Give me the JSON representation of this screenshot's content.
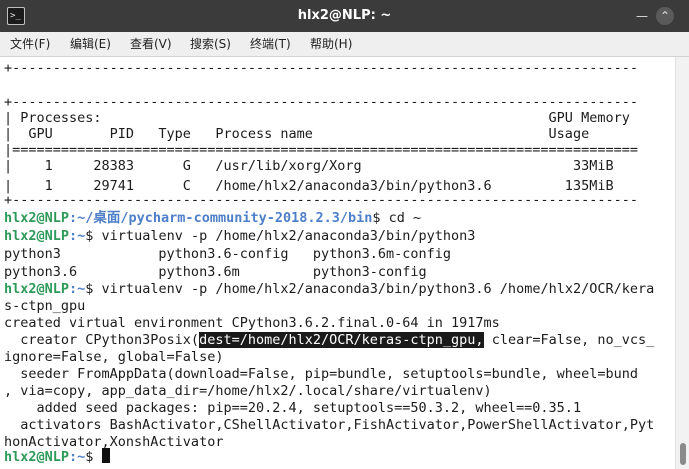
{
  "window": {
    "title": "hlx2@NLP: ~"
  },
  "menu": [
    "文件(F)",
    "编辑(E)",
    "查看(V)",
    "搜索(S)",
    "终端(T)",
    "帮助(H)"
  ],
  "terminal": {
    "lines": [
      "+-----------------------------------------------------------------------------",
      "",
      "+-----------------------------------------------------------------------------",
      "| Processes:                                                       GPU Memory",
      "|  GPU       PID   Type   Process name                             Usage",
      "|=============================================================================",
      "|    1     28383      G   /usr/lib/xorg/Xorg                          33MiB",
      "|    1     29741      C   /home/hlx2/anaconda3/bin/python3.6         135MiB",
      "+-----------------------------------------------------------------------------"
    ],
    "prompt_user": "hlx2@NLP",
    "session": [
      {
        "path": ":~/桌面/pycharm-community-2018.2.3/bin",
        "cmd": "$ cd ~"
      },
      {
        "path": ":~",
        "cmd": "$ virtualenv -p /home/hlx2/anaconda3/bin/python3"
      }
    ],
    "completions": [
      "python3            python3.6-config   python3.6m-config",
      "python3.6          python3.6m         python3-config"
    ],
    "second_cmd": {
      "path": ":~",
      "cmd": "$ virtualenv -p /home/hlx2/anaconda3/bin/python3.6 /home/hlx2/OCR/kera",
      "wrap": "s-ctpn_gpu"
    },
    "output": {
      "created": "created virtual environment CPython3.6.2.final.0-64 in 1917ms",
      "creator_prefix": "  creator CPython3Posix(",
      "creator_selected": "dest=/home/hlx2/OCR/keras-ctpn_gpu,",
      "creator_suffix": " clear=False, no_vcs_",
      "creator_wrap": "ignore=False, global=False)",
      "seeder": "  seeder FromAppData(download=False, pip=bundle, setuptools=bundle, wheel=bund",
      "seeder_wrap": ", via=copy, app_data_dir=/home/hlx2/.local/share/virtualenv)",
      "seed_packages": "    added seed packages: pip==20.2.4, setuptools==50.3.2, wheel==0.35.1",
      "activators": "  activators BashActivator,CShellActivator,FishActivator,PowerShellActivator,Pyt",
      "activators_wrap": "honActivator,XonshActivator"
    },
    "final_prompt": {
      "path": ":~",
      "cmd": "$ "
    }
  },
  "colors": {
    "prompt_user": "#2e9a5a",
    "prompt_path": "#4e7fc9",
    "titlebar": "#3b3b3b",
    "terminal_bg": "#ffffff"
  },
  "icons": {
    "app": "terminal-icon",
    "minimize": "minimize-icon",
    "maximize": "maximize-icon"
  }
}
